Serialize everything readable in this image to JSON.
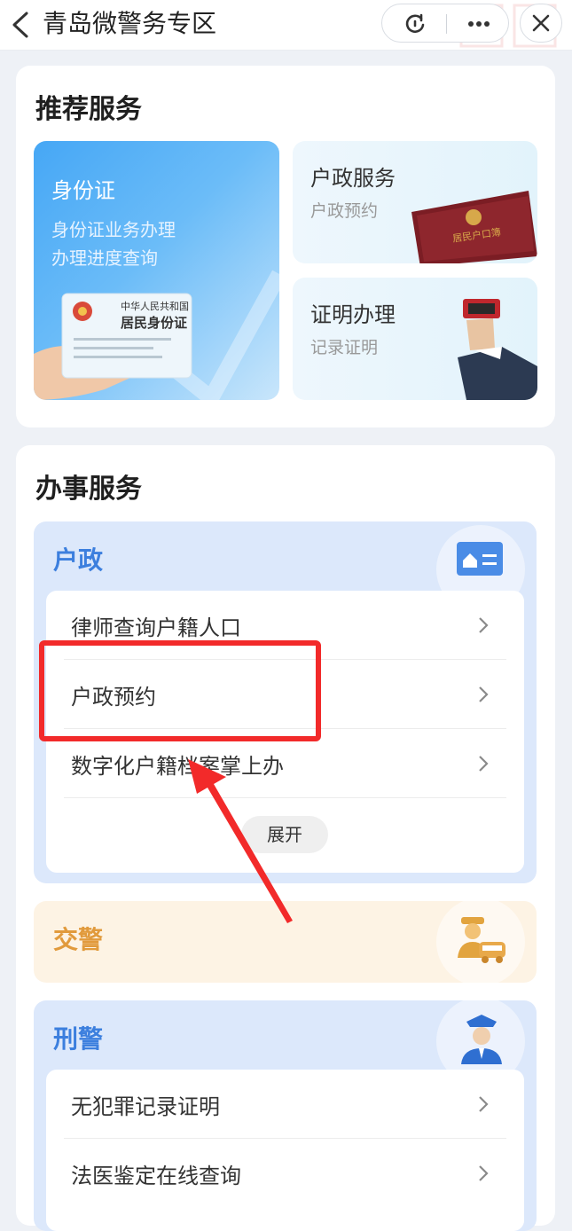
{
  "header": {
    "title": "青岛微警务专区"
  },
  "recommended": {
    "title": "推荐服务",
    "id_card": {
      "title": "身份证",
      "lines": [
        "身份证业务办理",
        "办理进度查询"
      ],
      "card_text": [
        "中华人民共和国",
        "居民身份证"
      ]
    },
    "household": {
      "title": "户政服务",
      "subtitle": "户政预约",
      "book_text": "居民户口簿"
    },
    "certificate": {
      "title": "证明办理",
      "subtitle": "记录证明"
    }
  },
  "services": {
    "title": "办事服务",
    "household": {
      "name": "户政",
      "items": [
        "律师查询户籍人口",
        "户政预约",
        "数字化户籍档案掌上办"
      ],
      "expand_label": "展开"
    },
    "traffic": {
      "name": "交警"
    },
    "criminal": {
      "name": "刑警",
      "items": [
        "无犯罪记录证明",
        "法医鉴定在线查询"
      ]
    }
  },
  "colors": {
    "accent_blue": "#3c7fde",
    "accent_orange": "#e19a3c",
    "annotation_red": "#f22a2a"
  }
}
